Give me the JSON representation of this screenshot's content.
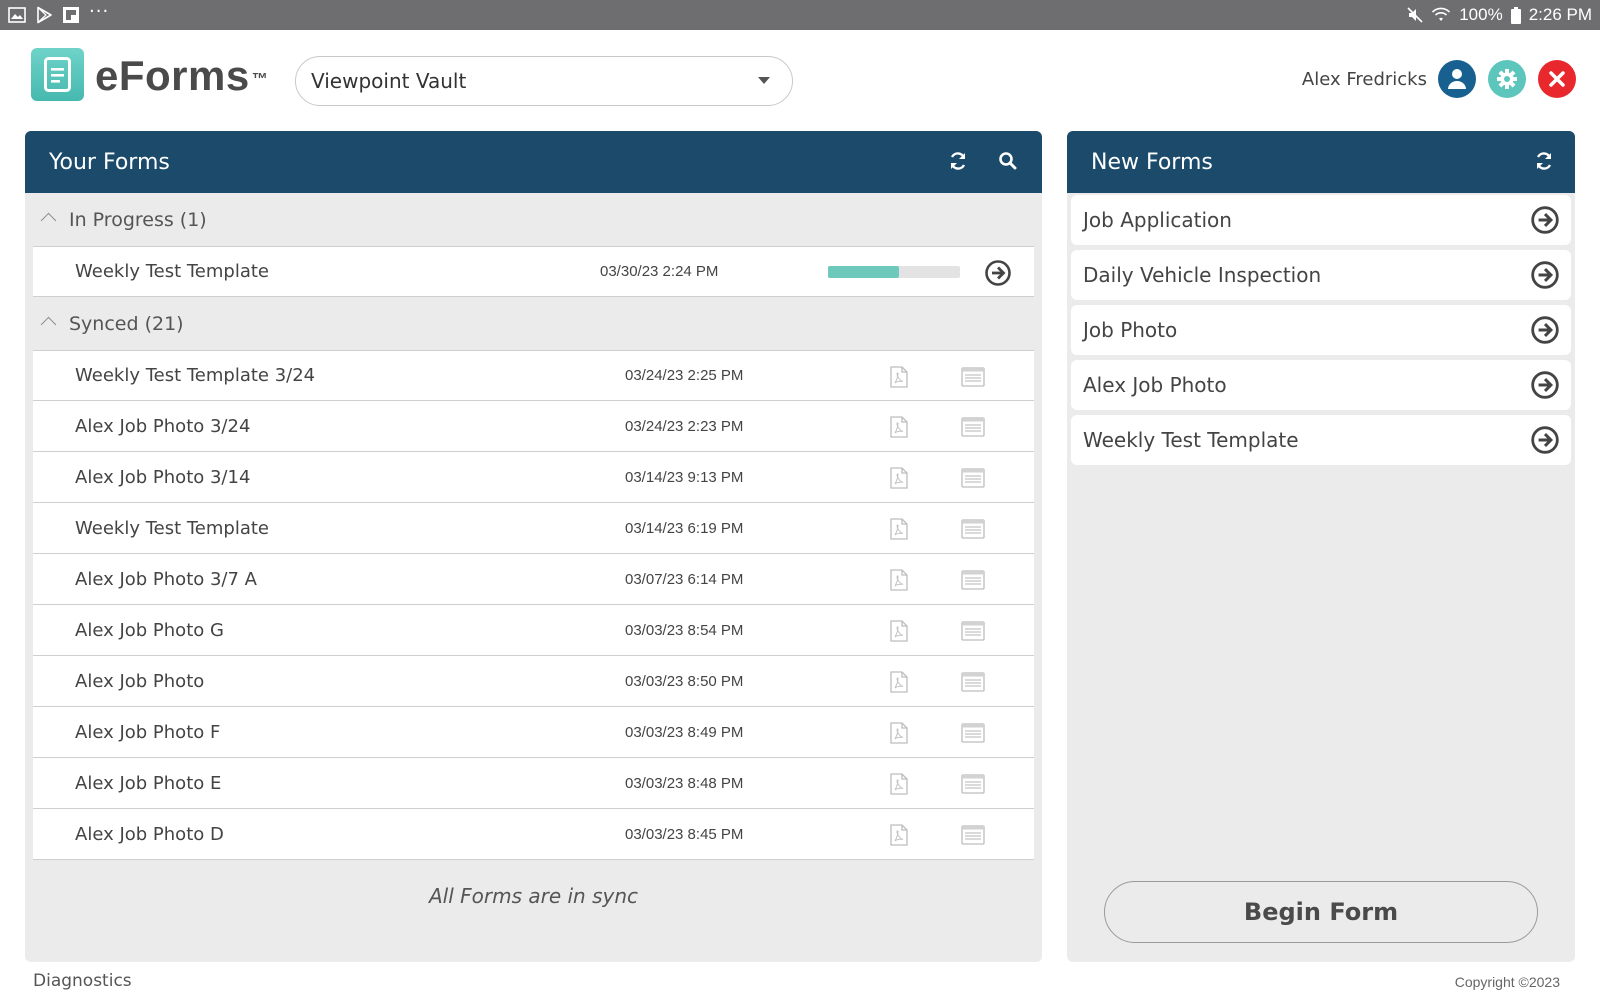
{
  "status_bar": {
    "battery": "100%",
    "time": "2:26 PM",
    "icons": [
      "gallery-icon",
      "play-store-icon",
      "flipboard-icon",
      "more-dots-icon",
      "mute-icon",
      "wifi-icon",
      "battery-icon"
    ]
  },
  "header": {
    "logo_text": "eForms",
    "logo_tm": "™",
    "vault": "Viewpoint Vault",
    "user_name": "Alex Fredricks",
    "buttons": [
      "user-icon",
      "gear-icon",
      "close-icon"
    ]
  },
  "your_forms": {
    "title": "Your Forms",
    "in_progress": {
      "label": "In Progress (1)",
      "items": [
        {
          "name": "Weekly Test Template",
          "date": "03/30/23 2:24 PM",
          "progress": 0.54
        }
      ]
    },
    "synced": {
      "label": "Synced (21)",
      "items": [
        {
          "name": "Weekly Test Template 3/24",
          "date": "03/24/23 2:25 PM"
        },
        {
          "name": "Alex Job Photo 3/24",
          "date": "03/24/23 2:23 PM"
        },
        {
          "name": "Alex Job Photo 3/14",
          "date": "03/14/23 9:13 PM"
        },
        {
          "name": "Weekly Test Template",
          "date": "03/14/23 6:19 PM"
        },
        {
          "name": "Alex Job Photo 3/7 A",
          "date": "03/07/23 6:14 PM"
        },
        {
          "name": "Alex Job Photo G",
          "date": "03/03/23 8:54 PM"
        },
        {
          "name": "Alex Job Photo",
          "date": "03/03/23 8:50 PM"
        },
        {
          "name": "Alex Job Photo F",
          "date": "03/03/23 8:49 PM"
        },
        {
          "name": "Alex Job Photo E",
          "date": "03/03/23 8:48 PM"
        },
        {
          "name": "Alex Job Photo D",
          "date": "03/03/23 8:45 PM"
        }
      ]
    },
    "sync_status": "All Forms are in sync"
  },
  "new_forms": {
    "title": "New Forms",
    "items": [
      {
        "name": "Job Application"
      },
      {
        "name": "Daily Vehicle Inspection"
      },
      {
        "name": "Job Photo"
      },
      {
        "name": "Alex Job Photo"
      },
      {
        "name": "Weekly Test Template"
      }
    ],
    "begin_label": "Begin Form"
  },
  "footer": {
    "diagnostics": "Diagnostics",
    "copyright": "Copyright ©2023"
  },
  "colors": {
    "panel_header": "#1b4a6b",
    "accent_teal": "#5cc6bd",
    "user_blue": "#17608f",
    "close_red": "#e8282d",
    "progress_fill": "#6ec9bd"
  }
}
